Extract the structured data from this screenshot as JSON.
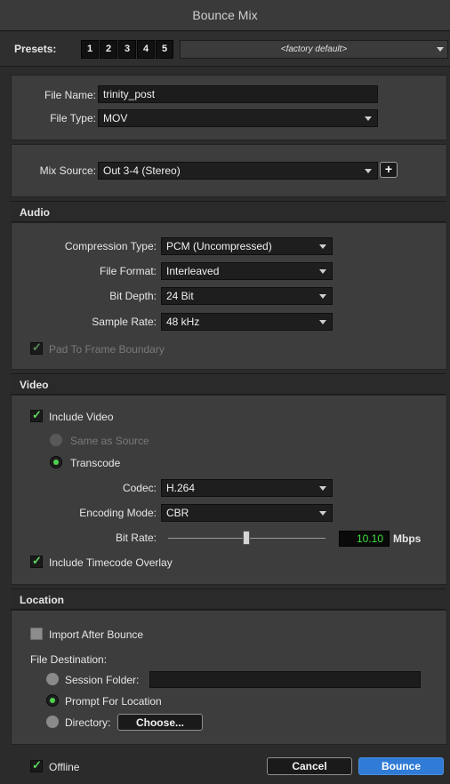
{
  "window": {
    "title": "Bounce Mix"
  },
  "presets": {
    "label": "Presets:",
    "buttons": [
      "1",
      "2",
      "3",
      "4",
      "5"
    ],
    "selected": "<factory default>"
  },
  "file": {
    "name_label": "File Name:",
    "name_value": "trinity_post",
    "type_label": "File Type:",
    "type_value": "MOV"
  },
  "mix": {
    "source_label": "Mix Source:",
    "source_value": "Out 3-4 (Stereo)",
    "add_label": "+"
  },
  "audio": {
    "header": "Audio",
    "compression_label": "Compression Type:",
    "compression_value": "PCM (Uncompressed)",
    "format_label": "File Format:",
    "format_value": "Interleaved",
    "bitdepth_label": "Bit Depth:",
    "bitdepth_value": "24 Bit",
    "samplerate_label": "Sample Rate:",
    "samplerate_value": "48 kHz",
    "pad_label": "Pad To Frame Boundary",
    "pad_checked": true
  },
  "video": {
    "header": "Video",
    "include_label": "Include Video",
    "include_checked": true,
    "same_source_label": "Same as Source",
    "transcode_label": "Transcode",
    "codec_label": "Codec:",
    "codec_value": "H.264",
    "encoding_label": "Encoding Mode:",
    "encoding_value": "CBR",
    "bitrate_label": "Bit Rate:",
    "bitrate_value": "10.10",
    "bitrate_unit": "Mbps",
    "timecode_label": "Include Timecode Overlay",
    "timecode_checked": true
  },
  "location": {
    "header": "Location",
    "import_label": "Import After Bounce",
    "import_checked": false,
    "destination_label": "File Destination:",
    "session_label": "Session Folder:",
    "session_value": "",
    "prompt_label": "Prompt For Location",
    "directory_label": "Directory:",
    "choose_label": "Choose..."
  },
  "footer": {
    "offline_label": "Offline",
    "offline_checked": true,
    "cancel_label": "Cancel",
    "bounce_label": "Bounce"
  },
  "colors": {
    "accent_blue": "#2f7bd6",
    "check_green": "#5fd65f",
    "bitrate_green": "#40e040"
  }
}
